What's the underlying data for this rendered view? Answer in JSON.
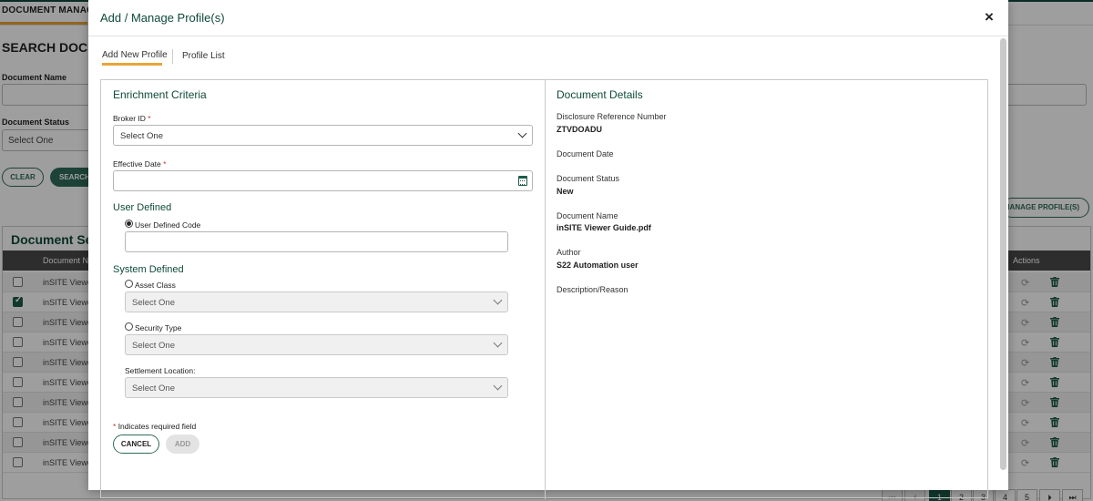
{
  "background": {
    "nav_tab": "DOCUMENT MANAGEM",
    "search_title": "SEARCH DOCUM",
    "document_name_label": "Document Name",
    "document_status_label": "Document Status",
    "document_status_value": "Select One",
    "clear_button": "CLEAR",
    "search_button": "SEARCH",
    "manage_profiles_button": "MANAGE PROFILE(S)",
    "results_title": "Document Sea",
    "columns": {
      "document_name": "Document Na",
      "actions": "Actions"
    },
    "rows": [
      {
        "name": "inSITE Viewe",
        "checked": false
      },
      {
        "name": "inSITE Viewe",
        "checked": true
      },
      {
        "name": "inSITE Viewe",
        "checked": false
      },
      {
        "name": "inSITE Viewe",
        "checked": false
      },
      {
        "name": "inSITE Viewe",
        "checked": false
      },
      {
        "name": "inSITE Viewe",
        "checked": false
      },
      {
        "name": "inSITE Viewe",
        "checked": false
      },
      {
        "name": "inSITE Viewe",
        "checked": false
      },
      {
        "name": "inSITE Viewe",
        "checked": false
      },
      {
        "name": "inSITE Viewe",
        "checked": false
      }
    ],
    "pagination": {
      "pages": [
        "1",
        "2",
        "3",
        "4",
        "5"
      ],
      "current": "1"
    }
  },
  "modal": {
    "title": "Add / Manage Profile(s)",
    "close_icon": "×",
    "tabs": {
      "add_new": "Add New Profile",
      "profile_list": "Profile List"
    },
    "enrichment": {
      "title": "Enrichment Criteria",
      "broker_id_label": "Broker ID",
      "broker_id_value": "Select One",
      "effective_date_label": "Effective Date",
      "effective_date_value": "",
      "required_mark": "*",
      "user_defined_title": "User Defined",
      "user_defined_code_label": "User Defined Code",
      "user_defined_code_value": "",
      "system_defined_title": "System Defined",
      "asset_class_label": "Asset Class",
      "asset_class_value": "Select One",
      "security_type_label": "Security Type",
      "security_type_value": "Select One",
      "settlement_location_label": "Settlement Location:",
      "settlement_location_value": "Select One",
      "required_note": "Indicates required field",
      "cancel_button": "CANCEL",
      "add_button": "ADD"
    },
    "document_details": {
      "title": "Document Details",
      "disclosure_ref_label": "Disclosure Reference Number",
      "disclosure_ref_value": "ZTVDOADU",
      "document_date_label": "Document Date",
      "document_status_label": "Document Status",
      "document_status_value": "New",
      "document_name_label": "Document Name",
      "document_name_value": "inSITE Viewer Guide.pdf",
      "author_label": "Author",
      "author_value": "S22 Automation user",
      "description_label": "Description/Reason"
    }
  },
  "colors": {
    "brand_green": "#0f4a3a",
    "accent_orange": "#e9a436",
    "required_red": "#c0392b"
  }
}
